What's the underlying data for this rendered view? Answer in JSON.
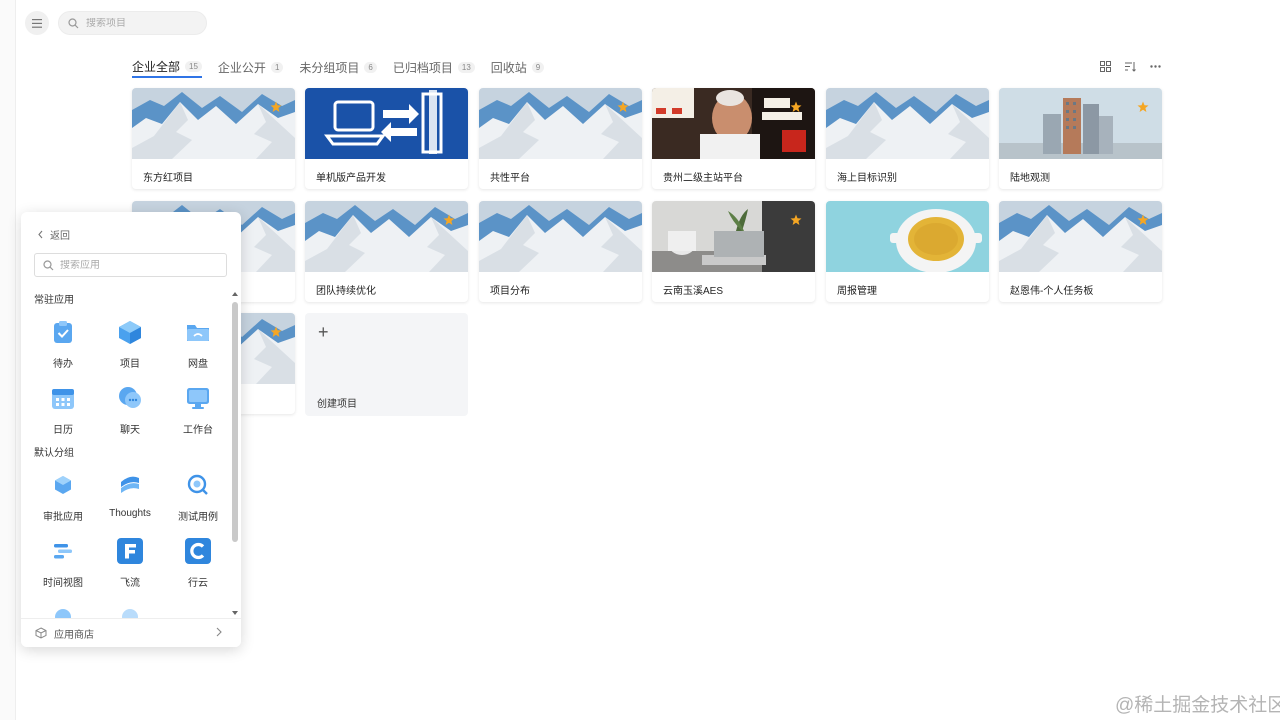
{
  "topbar": {
    "search_placeholder": "搜索项目"
  },
  "tabs": [
    {
      "label": "企业全部",
      "count": "15",
      "active": true
    },
    {
      "label": "企业公开",
      "count": "1"
    },
    {
      "label": "未分组项目",
      "count": "6"
    },
    {
      "label": "已归档项目",
      "count": "13"
    },
    {
      "label": "回收站",
      "count": "9"
    }
  ],
  "toolbar_icons": [
    "grid-view-icon",
    "sort-icon",
    "more-icon"
  ],
  "projects": [
    {
      "name": "东方红项目",
      "cover": "mountain",
      "starred": true
    },
    {
      "name": "单机版产品开发",
      "cover": "computer",
      "starred": false
    },
    {
      "name": "共性平台",
      "cover": "mountain",
      "starred": true
    },
    {
      "name": "贵州二级主站平台",
      "cover": "photo-man",
      "starred": true
    },
    {
      "name": "海上目标识别",
      "cover": "mountain",
      "starred": false
    },
    {
      "name": "陆地观测",
      "cover": "building",
      "starred": true
    },
    {
      "name": "",
      "cover": "mountain",
      "starred": false
    },
    {
      "name": "团队持续优化",
      "cover": "mountain",
      "starred": true
    },
    {
      "name": "项目分布",
      "cover": "mountain",
      "starred": false
    },
    {
      "name": "云南玉溪AES",
      "cover": "laptop",
      "starred": true
    },
    {
      "name": "周报管理",
      "cover": "coffee",
      "starred": false
    },
    {
      "name": "赵恩伟-个人任务板",
      "cover": "mountain",
      "starred": true
    },
    {
      "name": "",
      "cover": "mountain",
      "starred": true
    }
  ],
  "create_label": "创建项目",
  "panel": {
    "back_label": "返回",
    "search_placeholder": "搜索应用",
    "section_pinned": "常驻应用",
    "section_default": "默认分组",
    "pinned": [
      {
        "label": "待办",
        "icon": "todo-icon"
      },
      {
        "label": "项目",
        "icon": "project-cube-icon"
      },
      {
        "label": "网盘",
        "icon": "folder-icon"
      },
      {
        "label": "日历",
        "icon": "calendar-icon"
      },
      {
        "label": "聊天",
        "icon": "chat-icon"
      },
      {
        "label": "工作台",
        "icon": "workbench-icon"
      }
    ],
    "default_group": [
      {
        "label": "审批应用",
        "icon": "approval-icon"
      },
      {
        "label": "Thoughts",
        "icon": "thoughts-icon"
      },
      {
        "label": "测试用例",
        "icon": "test-case-icon"
      },
      {
        "label": "时间视图",
        "icon": "timeline-icon"
      },
      {
        "label": "飞流",
        "icon": "feiliu-icon"
      },
      {
        "label": "行云",
        "icon": "xingyun-icon"
      }
    ],
    "store_label": "应用商店"
  },
  "colors": {
    "accent": "#2f74e6",
    "star": "#f5a623"
  },
  "watermark": "@稀土掘金技术社区"
}
